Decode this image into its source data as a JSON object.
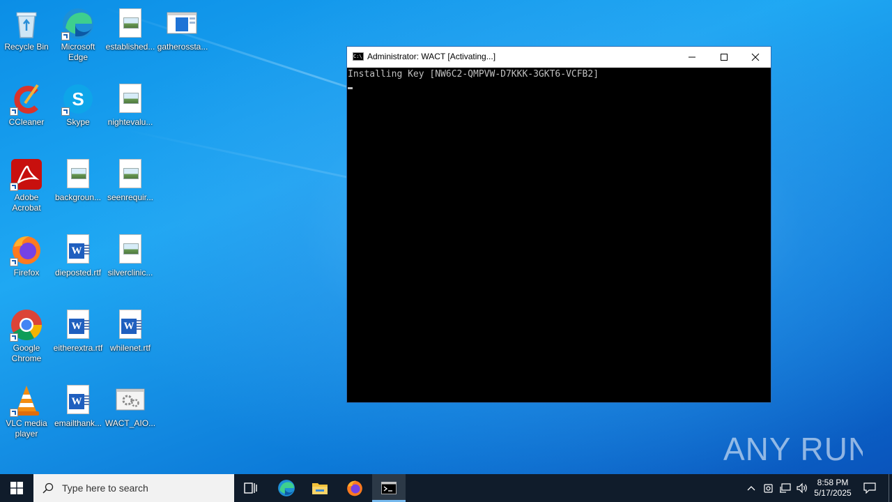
{
  "desktop": {
    "icons": [
      {
        "label": "Recycle Bin"
      },
      {
        "label": "Microsoft Edge"
      },
      {
        "label": "established..."
      },
      {
        "label": "gatherossta..."
      },
      {
        "label": "CCleaner"
      },
      {
        "label": "Skype"
      },
      {
        "label": "nightevalu..."
      },
      {
        "label": "Adobe Acrobat"
      },
      {
        "label": "backgroun..."
      },
      {
        "label": "seenrequir..."
      },
      {
        "label": "Firefox"
      },
      {
        "label": "dieposted.rtf"
      },
      {
        "label": "silverclinic..."
      },
      {
        "label": "Google Chrome"
      },
      {
        "label": "eitherextra.rtf"
      },
      {
        "label": "whilenet.rtf"
      },
      {
        "label": "VLC media player"
      },
      {
        "label": "emailthank..."
      },
      {
        "label": "WACT_AIO..."
      }
    ]
  },
  "console": {
    "title": "Administrator:  WACT [Activating...]",
    "output_line": "Installing Key [NW6C2-QMPVW-D7KKK-3GKT6-VCFB2]"
  },
  "watermark": {
    "text": "ANY RUN"
  },
  "taskbar": {
    "search_placeholder": "Type here to search",
    "time": "8:58 PM",
    "date": "5/17/2025"
  },
  "colors": {
    "desktop_blue": "#0c86df",
    "taskbar": "#101c2b",
    "console_bg": "#000000",
    "console_text": "#c0c0c0"
  }
}
